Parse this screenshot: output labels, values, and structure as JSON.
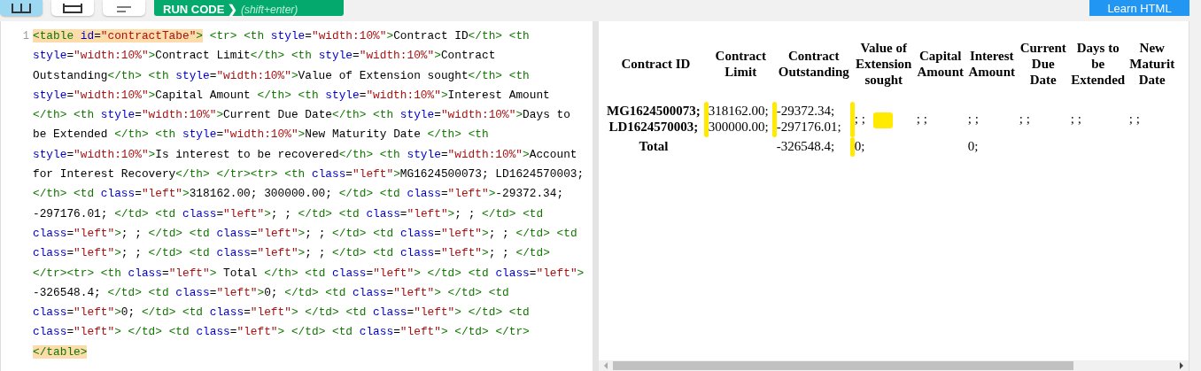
{
  "toolbar": {
    "layout_buttons": [
      {
        "kind": "split",
        "selected": true
      },
      {
        "kind": "stack",
        "selected": false
      },
      {
        "kind": "lines",
        "selected": false
      }
    ],
    "run_button": {
      "label": "RUN CODE ❯",
      "hint": "(shift+enter)"
    },
    "learn_button": "Learn HTML"
  },
  "editor": {
    "line_number": "1",
    "matched_tag_highlight": true,
    "lines": [
      "<table id=\"contractTabe\"> <tr> <th style=\"width:10%\">Contract ID</th> <th",
      "style=\"width:10%\">Contract Limit</th> <th style=\"width:10%\">Contract",
      "Outstanding</th> <th style=\"width:10%\">Value of Extension sought</th> <th",
      "style=\"width:10%\">Capital Amount </th> <th style=\"width:10%\">Interest Amount",
      "</th> <th style=\"width:10%\">Current Due Date</th> <th style=\"width:10%\">Days to",
      "be Extended </th> <th style=\"width:10%\">New Maturity Date </th> <th",
      "style=\"width:10%\">Is interest to be recovered</th> <th style=\"width:10%\">Account",
      "for Interest Recovery</th> </tr><tr> <th class=\"left\">MG1624500073; LD1624570003;",
      "</th> <td class=\"left\">318162.00; 300000.00; </td> <td class=\"left\">-29372.34;",
      "-297176.01; </td> <td class=\"left\">; ; </td> <td class=\"left\">; ; </td> <td",
      "class=\"left\">; ; </td> <td class=\"left\">; ; </td> <td class=\"left\">; ; </td> <td",
      "class=\"left\">; ; </td> <td class=\"left\">; ; </td> <td class=\"left\">; ; </td>",
      "</tr><tr> <th class=\"left\"> Total </th> <td class=\"left\"> </td> <td class=\"left\">",
      "-326548.4; </td> <td class=\"left\">0; </td> <td class=\"left\"> </td> <td",
      "class=\"left\">0; </td> <td class=\"left\"> </td> <td class=\"left\"> </td> <td",
      "class=\"left\"> </td> <td class=\"left\"> </td> <td class=\"left\"> </td> </tr>",
      "</table>"
    ]
  },
  "preview": {
    "table": {
      "columns": [
        "Contract ID",
        "Contract Limit",
        "Contract Outstanding",
        "Value of Extension sought",
        "Capital Amount",
        "Interest Amount",
        "Current Due Date",
        "Days to be Extended",
        "New Maturit Date"
      ],
      "rows": [
        {
          "cells": [
            {
              "kind": "header",
              "text": "MG1624500073; LD1624570003;",
              "highlighted": true
            },
            {
              "text": "318162.00; 300000.00;",
              "highlighted": true
            },
            {
              "text": "-29372.34; -297176.01;",
              "highlighted": true
            },
            {
              "kind": "blob",
              "text": "; ;",
              "highlighted": true
            },
            {
              "text": "; ;"
            },
            {
              "text": "; ;"
            },
            {
              "text": "; ;"
            },
            {
              "text": "; ;"
            },
            {
              "text": "; ;"
            }
          ]
        },
        {
          "cells": [
            {
              "kind": "header",
              "text": "Total"
            },
            {
              "text": ""
            },
            {
              "text": "-326548.4;",
              "highlighted": true
            },
            {
              "text": "0;"
            },
            {
              "text": ""
            },
            {
              "text": "0;"
            },
            {
              "text": ""
            },
            {
              "text": ""
            },
            {
              "text": ""
            }
          ]
        }
      ]
    }
  }
}
